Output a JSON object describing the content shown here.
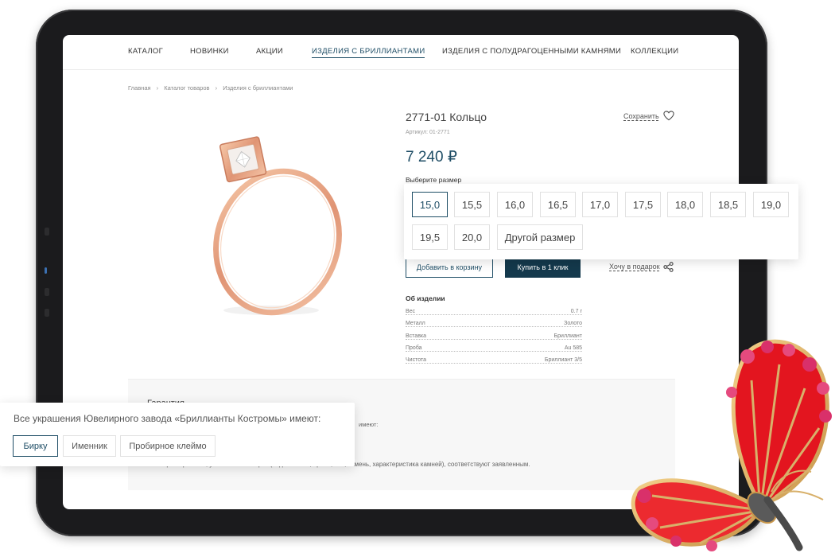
{
  "nav": {
    "items": [
      {
        "label": "КАТАЛОГ",
        "active": false
      },
      {
        "label": "НОВИНКИ",
        "active": false
      },
      {
        "label": "АКЦИИ",
        "active": false
      },
      {
        "label": "ИЗДЕЛИЯ С БРИЛЛИАНТАМИ",
        "active": true
      },
      {
        "label": "ИЗДЕЛИЯ С ПОЛУДРАГОЦЕННЫМИ КАМНЯМИ",
        "active": false
      },
      {
        "label": "КОЛЛЕКЦИИ",
        "active": false
      }
    ]
  },
  "breadcrumb": {
    "home": "Главная",
    "sep": "›",
    "catalog": "Каталог товаров",
    "current": "Изделия с бриллиантами"
  },
  "product": {
    "title": "2771-01 Кольцо",
    "article": "Артикул: 01-2771",
    "save_label": "Сохранить",
    "price": "7 240 ₽",
    "choose_size": "Выберите размер",
    "sizes": [
      "15,0",
      "15,5",
      "16,0",
      "16,5",
      "17,0",
      "17,5",
      "18,0",
      "18,5",
      "19,0",
      "19,5",
      "20,0",
      "Другой размер"
    ],
    "selected_size": "15,0",
    "add_to_cart": "Добавить в корзину",
    "buy_one_click": "Купить в 1 клик",
    "gift_label": "Хочу в подарок",
    "about_title": "Об изделии",
    "specs": [
      {
        "key": "Вес",
        "value": "0.7 г"
      },
      {
        "key": "Металл",
        "value": "Золото"
      },
      {
        "key": "Вставка",
        "value": "Бриллиант"
      },
      {
        "key": "Проба",
        "value": "Au 585"
      },
      {
        "key": "Чистота",
        "value": "Бриллиант 3/5"
      }
    ]
  },
  "guarantee": {
    "title": "Гарантия",
    "line1": "имеют:",
    "line2": "Все характеристики, указанные на бирке (вид металла, проба, вес, камень, характеристика камней), соответствуют заявленным."
  },
  "tags_card": {
    "title": "Все украшения Ювелирного завода «Бриллианты Костромы» имеют:",
    "tags": [
      "Бирку",
      "Именник",
      "Пробирное клеймо"
    ],
    "selected": "Бирку"
  },
  "colors": {
    "accent": "#1f4e66",
    "button_dark": "#14394c",
    "ring_gold": "#e8a887",
    "enamel_red": "#e3151f"
  }
}
